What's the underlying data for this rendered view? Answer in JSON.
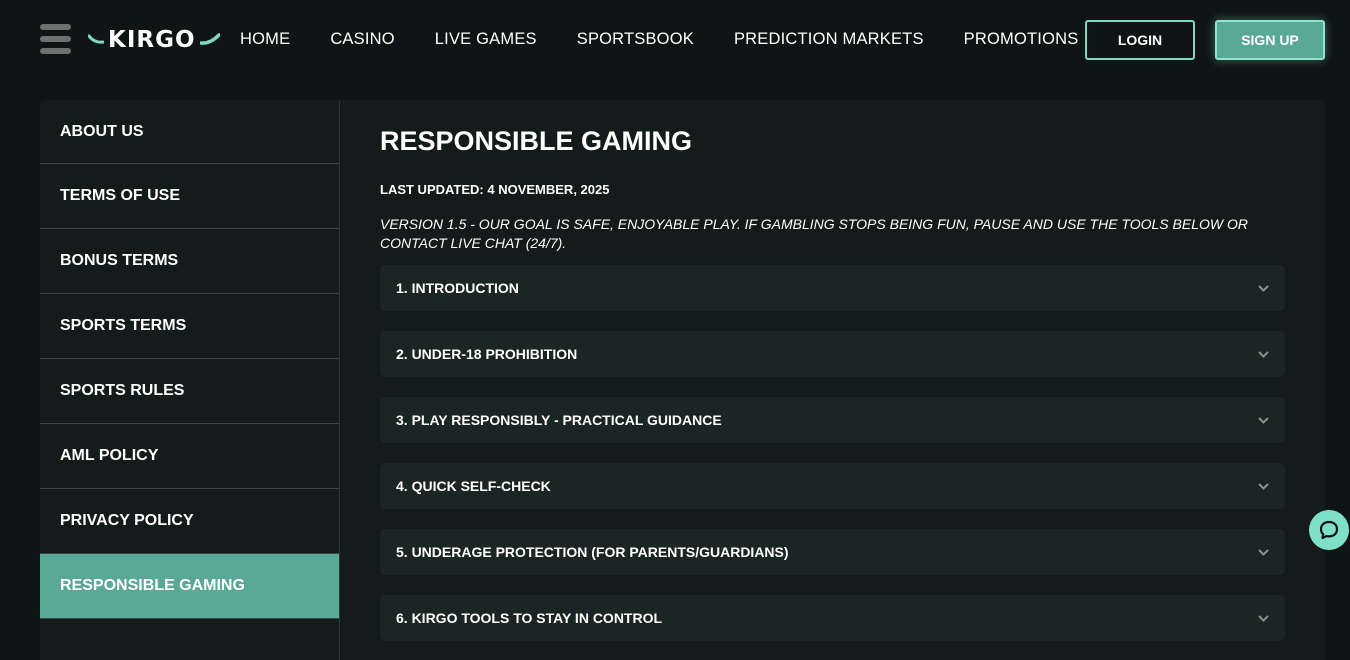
{
  "brand": {
    "logo_text": "KIRGO",
    "accent": "#5aa996",
    "accent_light": "#7fd6c2"
  },
  "nav": {
    "items": [
      {
        "label": "HOME"
      },
      {
        "label": "CASINO"
      },
      {
        "label": "LIVE GAMES"
      },
      {
        "label": "SPORTSBOOK"
      },
      {
        "label": "PREDICTION MARKETS"
      },
      {
        "label": "PROMOTIONS"
      }
    ]
  },
  "auth": {
    "login_label": "LOGIN",
    "signup_label": "SIGN UP"
  },
  "sidebar": {
    "items": [
      {
        "label": "ABOUT US",
        "active": false
      },
      {
        "label": "TERMS OF USE",
        "active": false
      },
      {
        "label": "BONUS TERMS",
        "active": false
      },
      {
        "label": "SPORTS TERMS",
        "active": false
      },
      {
        "label": "SPORTS RULES",
        "active": false
      },
      {
        "label": "AML POLICY",
        "active": false
      },
      {
        "label": "PRIVACY POLICY",
        "active": false
      },
      {
        "label": "RESPONSIBLE GAMING",
        "active": true
      }
    ]
  },
  "main": {
    "title": "RESPONSIBLE GAMING",
    "updated": "LAST UPDATED: 4 NOVEMBER, 2025",
    "version_note": "VERSION 1.5 - OUR GOAL IS SAFE, ENJOYABLE PLAY. IF GAMBLING STOPS BEING FUN, PAUSE AND USE THE TOOLS BELOW OR CONTACT LIVE CHAT (24/7).",
    "sections": [
      {
        "label": "1. INTRODUCTION"
      },
      {
        "label": "2. UNDER-18 PROHIBITION"
      },
      {
        "label": "3. PLAY RESPONSIBLY - PRACTICAL GUIDANCE"
      },
      {
        "label": "4. QUICK SELF-CHECK"
      },
      {
        "label": "5. UNDERAGE PROTECTION (FOR PARENTS/GUARDIANS)"
      },
      {
        "label": "6. KIRGO TOOLS TO STAY IN CONTROL"
      }
    ]
  },
  "icons": {
    "menu": "hamburger-menu-icon",
    "chevron": "chevron-down-icon",
    "chat": "chat-bubble-icon"
  }
}
